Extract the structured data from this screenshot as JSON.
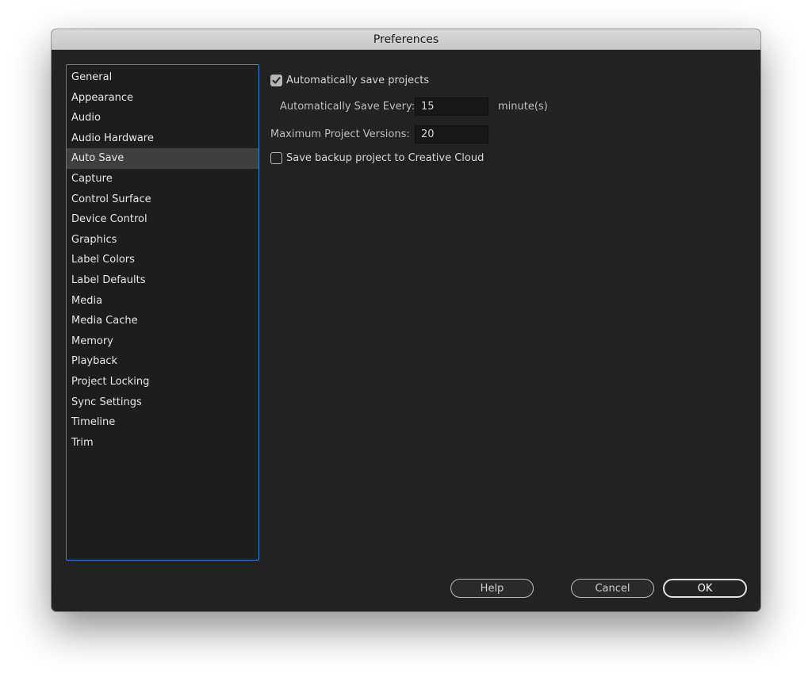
{
  "window": {
    "title": "Preferences"
  },
  "sidebar": {
    "items": [
      {
        "label": "General"
      },
      {
        "label": "Appearance"
      },
      {
        "label": "Audio"
      },
      {
        "label": "Audio Hardware"
      },
      {
        "label": "Auto Save",
        "selected": true
      },
      {
        "label": "Capture"
      },
      {
        "label": "Control Surface"
      },
      {
        "label": "Device Control"
      },
      {
        "label": "Graphics"
      },
      {
        "label": "Label Colors"
      },
      {
        "label": "Label Defaults"
      },
      {
        "label": "Media"
      },
      {
        "label": "Media Cache"
      },
      {
        "label": "Memory"
      },
      {
        "label": "Playback"
      },
      {
        "label": "Project Locking"
      },
      {
        "label": "Sync Settings"
      },
      {
        "label": "Timeline"
      },
      {
        "label": "Trim"
      }
    ]
  },
  "auto_save": {
    "auto_save_projects": {
      "label": "Automatically save projects",
      "checked": true
    },
    "save_every": {
      "label": "Automatically Save Every:",
      "value": "15",
      "unit": "minute(s)"
    },
    "max_versions": {
      "label": "Maximum Project Versions:",
      "value": "20"
    },
    "backup_cloud": {
      "label": "Save backup project to Creative Cloud",
      "checked": false
    }
  },
  "buttons": {
    "help": "Help",
    "cancel": "Cancel",
    "ok": "OK"
  },
  "colors": {
    "accent": "#3b83d6",
    "background": "#222222",
    "selected_row": "#3f3f3f"
  },
  "icons": {
    "checkmark": "checkmark-icon"
  }
}
